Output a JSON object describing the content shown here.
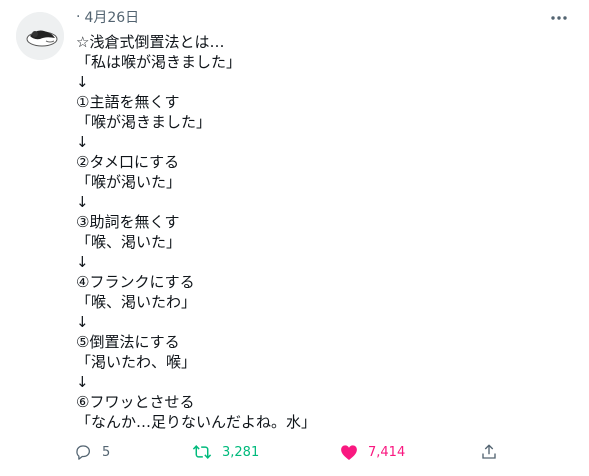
{
  "tweet": {
    "date_separator": "·",
    "date": "4月26日",
    "lines": [
      "☆浅倉式倒置法とは…",
      "「私は喉が渇きました」",
      "↓",
      "①主語を無くす",
      "「喉が渇きました」",
      "↓",
      "②タメ口にする",
      "「喉が渇いた」",
      "↓",
      "③助詞を無くす",
      "「喉、渇いた」",
      "↓",
      "④フランクにする",
      "「喉、渇いたわ」",
      "↓",
      "⑤倒置法にする",
      "「渇いたわ、喉」",
      "↓",
      "⑥フワッとさせる",
      "「なんか…足りないんだよね。水」"
    ]
  },
  "actions": {
    "reply": {
      "icon": "reply-icon",
      "count": "5"
    },
    "retweet": {
      "icon": "retweet-icon",
      "count": "3,281",
      "color": "#00ba7c"
    },
    "like": {
      "icon": "heart-filled-icon",
      "count": "7,414",
      "color": "#f91880"
    },
    "share": {
      "icon": "share-icon"
    }
  }
}
